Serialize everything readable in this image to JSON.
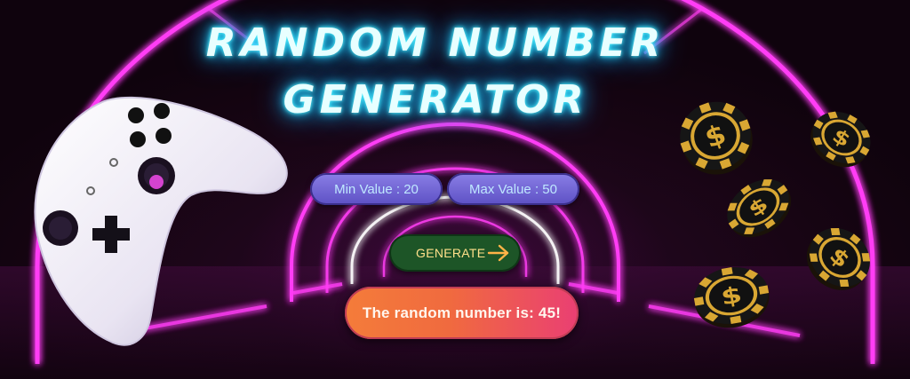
{
  "title": {
    "line1": "RANDOM NUMBER",
    "line2": "GENERATOR"
  },
  "inputs": {
    "min_label": "Min Value : 20",
    "max_label": "Max Value : 50"
  },
  "generate": {
    "label": "GENERATE",
    "icon": "arrow-right-icon"
  },
  "result": {
    "text": "The random number is: 45!"
  },
  "colors": {
    "neon_pink": "#ff3df5",
    "title_glow": "#22d8ff",
    "pill_purple": "#6f63d6",
    "generate_green": "#1d5527",
    "result_orange": "#f47c3a",
    "result_pink": "#ea3f73",
    "chip_gold": "#d9a733"
  },
  "decorations": [
    "game-controller-image",
    "casino-chips-image",
    "neon-tunnel-background"
  ]
}
